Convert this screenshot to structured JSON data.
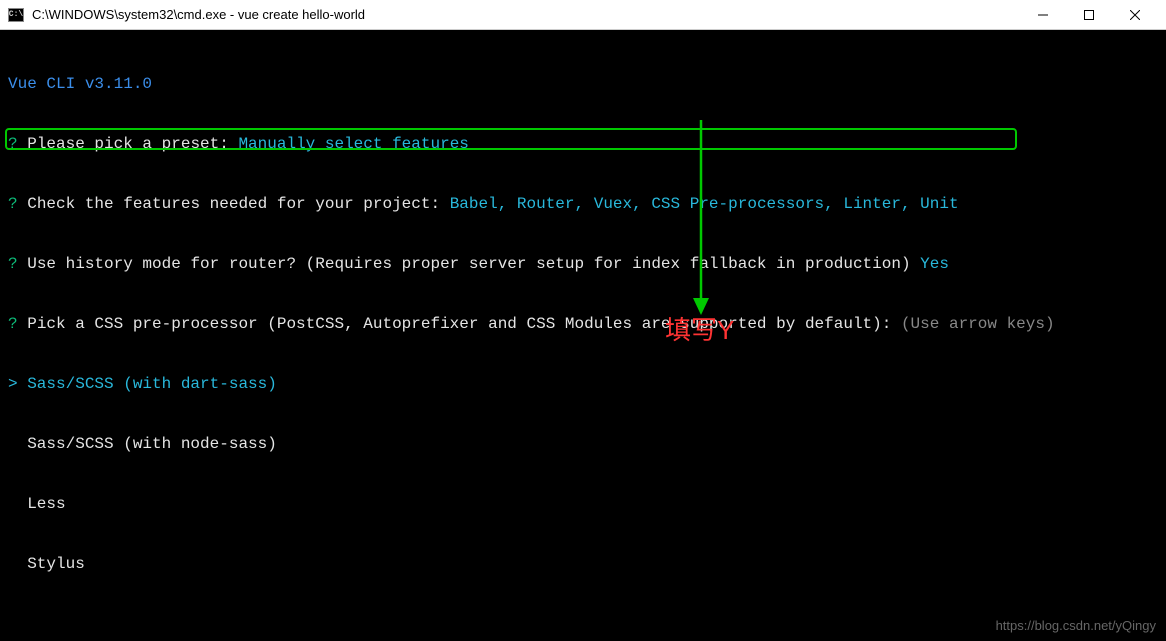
{
  "window": {
    "title": "C:\\WINDOWS\\system32\\cmd.exe - vue  create hello-world"
  },
  "terminal": {
    "header": "Vue CLI v3.11.0",
    "q1": {
      "prompt": "?",
      "text": " Please pick a preset: ",
      "answer": "Manually select features"
    },
    "q2": {
      "prompt": "?",
      "text": " Check the features needed for your project: ",
      "answer": "Babel, Router, Vuex, CSS Pre-processors, Linter, Unit"
    },
    "q3": {
      "prompt": "?",
      "text": " Use history mode for router? ",
      "hint": "(Requires proper server setup for index fallback in production)",
      "answer": " Yes"
    },
    "q4": {
      "prompt": "?",
      "text": " Pick a CSS pre-processor (PostCSS, Autoprefixer and CSS Modules are supported by default): ",
      "hint": "(Use arrow keys)"
    },
    "options": {
      "selected_prefix": "> ",
      "unselected_prefix": "  ",
      "opt1": "Sass/SCSS (with dart-sass)",
      "opt2": "Sass/SCSS (with node-sass)",
      "opt3": "Less",
      "opt4": "Stylus"
    }
  },
  "annotation": {
    "label": "填写Y"
  },
  "watermark": "https://blog.csdn.net/yQingy"
}
